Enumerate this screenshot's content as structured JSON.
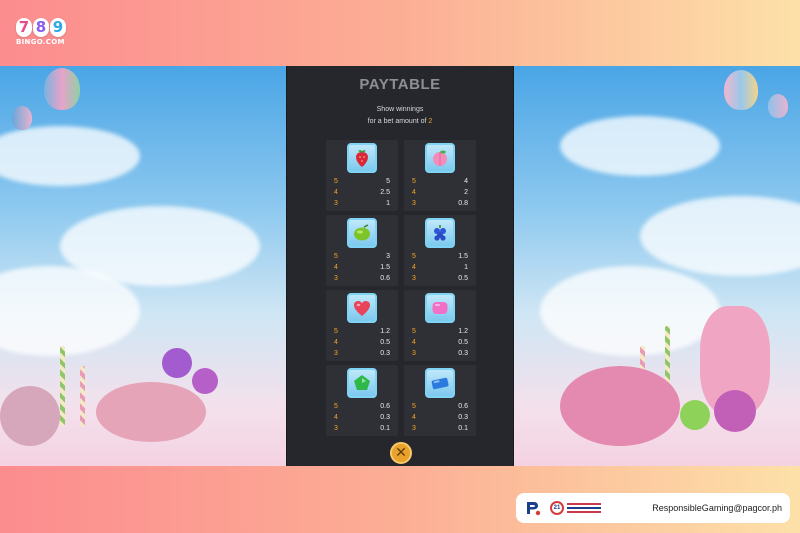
{
  "brand": {
    "digits": [
      "7",
      "8",
      "9"
    ],
    "sub": "BINGO.COM"
  },
  "paytable": {
    "title": "PAYTABLE",
    "subtitle_line1": "Show winnings",
    "subtitle_line2_prefix": "for a bet amount of ",
    "bet_amount": "2",
    "symbols": [
      {
        "icon": "strawberry-icon",
        "color": "#d9263a",
        "pays": [
          {
            "count": "5",
            "value": "5"
          },
          {
            "count": "4",
            "value": "2.5"
          },
          {
            "count": "3",
            "value": "1"
          }
        ]
      },
      {
        "icon": "peach-icon",
        "color": "#f58bb8",
        "pays": [
          {
            "count": "5",
            "value": "4"
          },
          {
            "count": "4",
            "value": "2"
          },
          {
            "count": "3",
            "value": "0.8"
          }
        ]
      },
      {
        "icon": "lime-icon",
        "color": "#7cc42a",
        "pays": [
          {
            "count": "5",
            "value": "3"
          },
          {
            "count": "4",
            "value": "1.5"
          },
          {
            "count": "3",
            "value": "0.6"
          }
        ]
      },
      {
        "icon": "grapes-icon",
        "color": "#2f55d6",
        "pays": [
          {
            "count": "5",
            "value": "1.5"
          },
          {
            "count": "4",
            "value": "1"
          },
          {
            "count": "3",
            "value": "0.5"
          }
        ]
      },
      {
        "icon": "heart-candy-icon",
        "color": "#e8455a",
        "pays": [
          {
            "count": "5",
            "value": "1.2"
          },
          {
            "count": "4",
            "value": "0.5"
          },
          {
            "count": "3",
            "value": "0.3"
          }
        ]
      },
      {
        "icon": "square-candy-icon",
        "color": "#f070c8",
        "pays": [
          {
            "count": "5",
            "value": "1.2"
          },
          {
            "count": "4",
            "value": "0.5"
          },
          {
            "count": "3",
            "value": "0.3"
          }
        ]
      },
      {
        "icon": "pentagon-candy-icon",
        "color": "#2fb84a",
        "pays": [
          {
            "count": "5",
            "value": "0.6"
          },
          {
            "count": "4",
            "value": "0.3"
          },
          {
            "count": "3",
            "value": "0.1"
          }
        ]
      },
      {
        "icon": "oblong-candy-icon",
        "color": "#2b7ae0",
        "pays": [
          {
            "count": "5",
            "value": "0.6"
          },
          {
            "count": "4",
            "value": "0.3"
          },
          {
            "count": "3",
            "value": "0.1"
          }
        ]
      }
    ],
    "close_glyph": "✕",
    "accent": "#f2a623"
  },
  "footer": {
    "email": "ResponsibleGaming@pagcor.ph",
    "age": "21"
  }
}
